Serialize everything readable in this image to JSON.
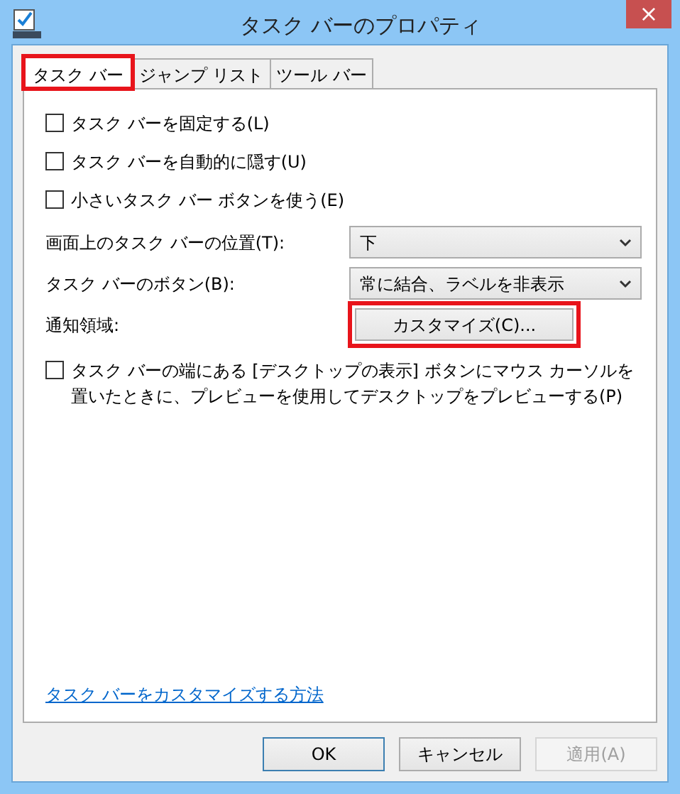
{
  "window": {
    "title": "タスク バーのプロパティ",
    "close": "×"
  },
  "tabs": [
    {
      "label": "タスク バー",
      "selected": true,
      "highlighted": true
    },
    {
      "label": "ジャンプ リスト",
      "selected": false,
      "highlighted": false
    },
    {
      "label": "ツール バー",
      "selected": false,
      "highlighted": false
    }
  ],
  "options": [
    {
      "kind": "checkbox",
      "label": "タスク バーを固定する(L)",
      "checked": false
    },
    {
      "kind": "checkbox",
      "label": "タスク バーを自動的に隠す(U)",
      "checked": false
    },
    {
      "kind": "checkbox",
      "label": "小さいタスク バー ボタンを使う(E)",
      "checked": false
    },
    {
      "kind": "select",
      "label": "画面上のタスク バーの位置(T):",
      "value": "下"
    },
    {
      "kind": "select",
      "label": "タスク バーのボタン(B):",
      "value": "常に結合、ラベルを非表示"
    },
    {
      "kind": "button",
      "label": "通知領域:",
      "button": "カスタマイズ(C)...",
      "highlighted": true
    },
    {
      "kind": "checkbox",
      "label": "タスク バーの端にある [デスクトップの表示] ボタンにマウス カーソルを置いたときに、プレビューを使用してデスクトップをプレビューする(P)",
      "checked": false
    }
  ],
  "help_link": "タスク バーをカスタマイズする方法",
  "buttons": [
    {
      "label": "OK",
      "default": true,
      "disabled": false
    },
    {
      "label": "キャンセル",
      "default": false,
      "disabled": false
    },
    {
      "label": "適用(A)",
      "default": false,
      "disabled": true
    }
  ]
}
